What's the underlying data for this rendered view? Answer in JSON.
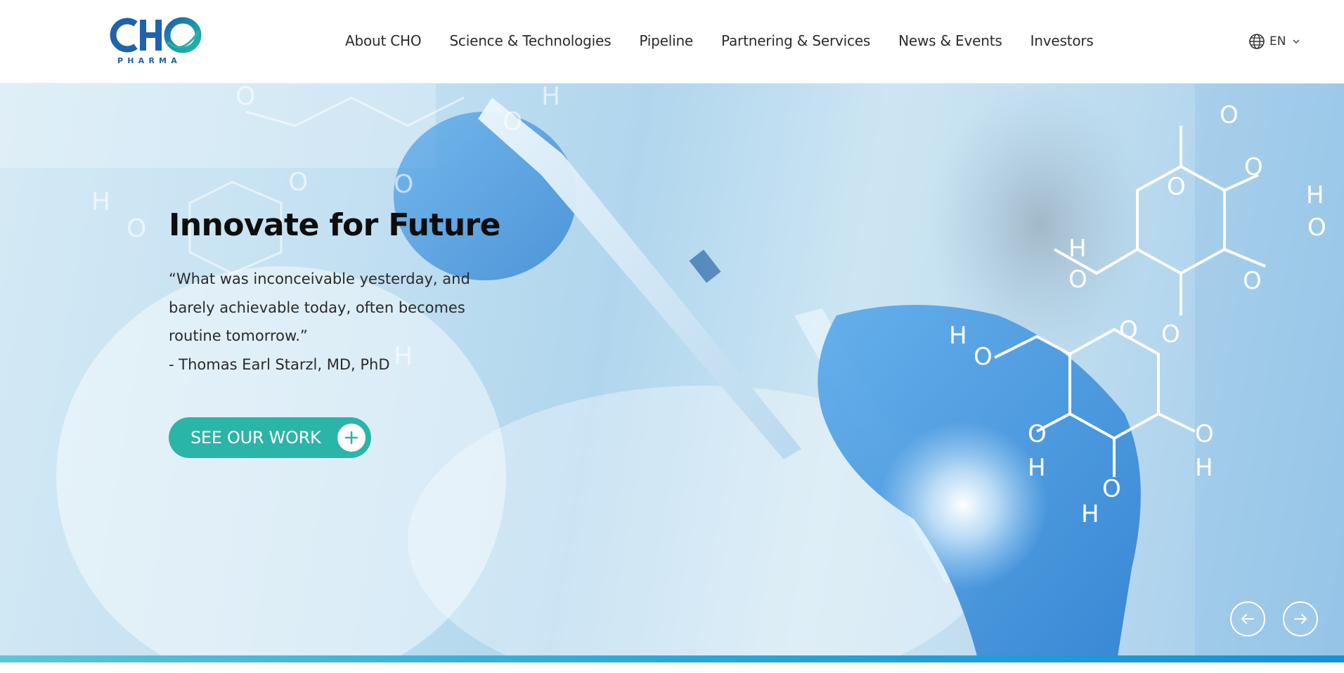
{
  "header": {
    "logo": {
      "wordmark": "CHO",
      "sub": "PHARMA"
    },
    "nav": [
      {
        "label": "About CHO"
      },
      {
        "label": "Science & Technologies"
      },
      {
        "label": "Pipeline"
      },
      {
        "label": "Partnering & Services"
      },
      {
        "label": "News & Events"
      },
      {
        "label": "Investors"
      }
    ],
    "language": {
      "label": "EN",
      "icon": "globe-icon"
    }
  },
  "hero": {
    "title": "Innovate for Future",
    "quote_lines": [
      "“What was inconceivable yesterday, and",
      "barely achievable today, often becomes",
      "routine tomorrow.”",
      "- Thomas Earl Starzl, MD, PhD"
    ],
    "cta": {
      "label": "SEE OUR WORK",
      "icon": "plus-icon"
    },
    "carousel": {
      "prev_icon": "arrow-left-icon",
      "next_icon": "arrow-right-icon"
    }
  },
  "colors": {
    "brand_blue": "#1f62ad",
    "brand_teal": "#2ab5a8",
    "accent_bar": "#1592d4",
    "nav_text": "#2b2b2b"
  }
}
